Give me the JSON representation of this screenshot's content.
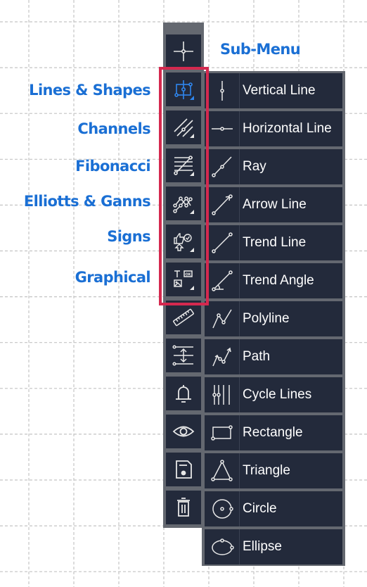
{
  "colors": {
    "accent_blue": "#1a6fd4",
    "highlight_red": "#d4294f",
    "panel_bg": "#232a3b",
    "panel_border": "#646870",
    "icon_white": "#e8e8e8",
    "active_icon": "#2f86ee",
    "grid_line": "#c4c4c4"
  },
  "annotations": {
    "categories": [
      "Lines & Shapes",
      "Channels",
      "Fibonacci",
      "Elliotts & Ganns",
      "Signs",
      "Graphical"
    ],
    "submenu_title": "Sub-Menu"
  },
  "toolbar": {
    "items": [
      {
        "icon": "crosshair-icon",
        "name": "Crosshair"
      },
      {
        "icon": "lines-shapes-icon",
        "name": "Lines & Shapes",
        "active": true,
        "has_submenu": true
      },
      {
        "icon": "channels-icon",
        "name": "Channels",
        "has_submenu": true
      },
      {
        "icon": "fibonacci-icon",
        "name": "Fibonacci",
        "has_submenu": true
      },
      {
        "icon": "elliott-gann-icon",
        "name": "Elliotts & Ganns",
        "has_submenu": true
      },
      {
        "icon": "signs-icon",
        "name": "Signs",
        "has_submenu": true
      },
      {
        "icon": "graphical-icon",
        "name": "Graphical",
        "has_submenu": true
      },
      {
        "icon": "ruler-icon",
        "name": "Measure"
      },
      {
        "icon": "magnet-align-icon",
        "name": "Align"
      },
      {
        "icon": "bell-icon",
        "name": "Alerts"
      },
      {
        "icon": "eye-icon",
        "name": "Visibility"
      },
      {
        "icon": "save-icon",
        "name": "Save"
      },
      {
        "icon": "trash-icon",
        "name": "Delete"
      }
    ]
  },
  "submenu": {
    "items": [
      {
        "label": "Vertical Line",
        "icon": "vertical-line-icon"
      },
      {
        "label": "Horizontal Line",
        "icon": "horizontal-line-icon"
      },
      {
        "label": "Ray",
        "icon": "ray-icon"
      },
      {
        "label": "Arrow Line",
        "icon": "arrow-line-icon"
      },
      {
        "label": "Trend Line",
        "icon": "trend-line-icon"
      },
      {
        "label": "Trend Angle",
        "icon": "trend-angle-icon"
      },
      {
        "label": "Polyline",
        "icon": "polyline-icon"
      },
      {
        "label": "Path",
        "icon": "path-icon"
      },
      {
        "label": "Cycle Lines",
        "icon": "cycle-lines-icon"
      },
      {
        "label": "Rectangle",
        "icon": "rectangle-icon"
      },
      {
        "label": "Triangle",
        "icon": "triangle-icon"
      },
      {
        "label": "Circle",
        "icon": "circle-icon"
      },
      {
        "label": "Ellipse",
        "icon": "ellipse-icon"
      }
    ]
  }
}
